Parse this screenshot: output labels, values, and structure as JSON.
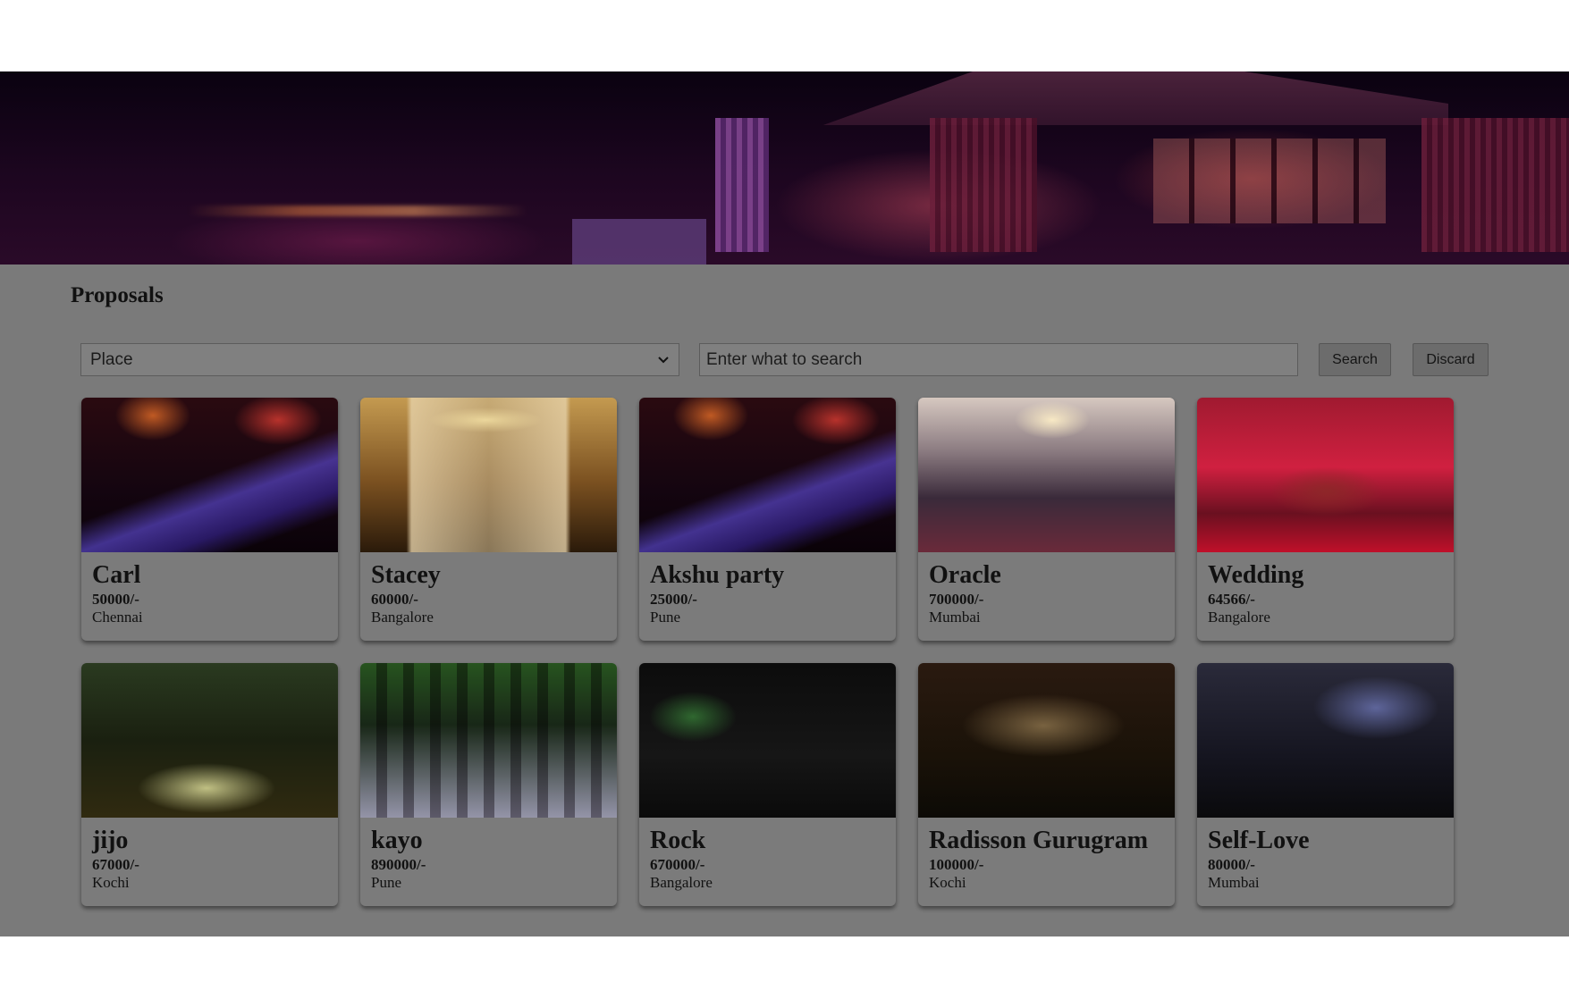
{
  "header": {
    "banner_image": "event-venue-banner"
  },
  "page": {
    "title": "Proposals"
  },
  "filters": {
    "place_select": "Place",
    "search_placeholder": "Enter what to search",
    "search_label": "Search",
    "discard_label": "Discard"
  },
  "proposals": [
    {
      "name": "Carl",
      "price": "50000/-",
      "place": "Chennai"
    },
    {
      "name": "Stacey",
      "price": "60000/-",
      "place": "Bangalore"
    },
    {
      "name": "Akshu party",
      "price": "25000/-",
      "place": "Pune"
    },
    {
      "name": "Oracle",
      "price": "700000/-",
      "place": "Mumbai"
    },
    {
      "name": "Wedding",
      "price": "64566/-",
      "place": "Bangalore"
    },
    {
      "name": "jijo",
      "price": "67000/-",
      "place": "Kochi"
    },
    {
      "name": "kayo",
      "price": "890000/-",
      "place": "Pune"
    },
    {
      "name": "Rock",
      "price": "670000/-",
      "place": "Bangalore"
    },
    {
      "name": "Radisson Gurugram",
      "price": "100000/-",
      "place": "Kochi"
    },
    {
      "name": "Self-Love",
      "price": "80000/-",
      "place": "Mumbai"
    }
  ]
}
